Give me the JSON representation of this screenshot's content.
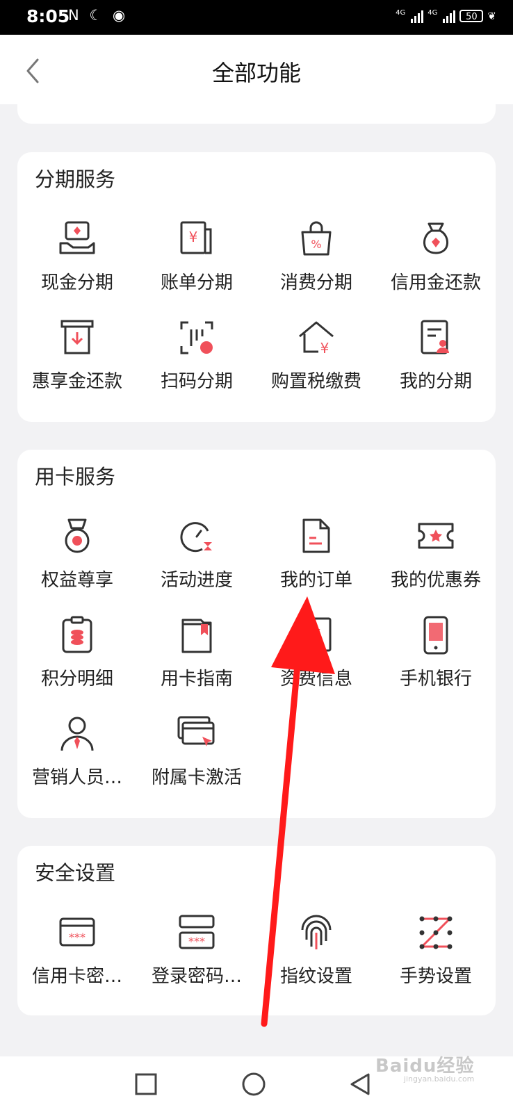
{
  "status_bar": {
    "time": "8:05",
    "left_icons": "N ☾ ◉",
    "signal1_label": "4G",
    "signal2_label": "4G",
    "battery": "50"
  },
  "header": {
    "title": "全部功能"
  },
  "sections": [
    {
      "title": "分期服务",
      "items": [
        {
          "label": "现金分期",
          "icon": "cash-installment-icon"
        },
        {
          "label": "账单分期",
          "icon": "bill-installment-icon"
        },
        {
          "label": "消费分期",
          "icon": "shopping-bag-icon"
        },
        {
          "label": "信用金还款",
          "icon": "money-bag-icon"
        },
        {
          "label": "惠享金还款",
          "icon": "download-box-icon"
        },
        {
          "label": "扫码分期",
          "icon": "scan-icon"
        },
        {
          "label": "购置税缴费",
          "icon": "house-yen-icon"
        },
        {
          "label": "我的分期",
          "icon": "document-person-icon"
        }
      ]
    },
    {
      "title": "用卡服务",
      "items": [
        {
          "label": "权益尊享",
          "icon": "medal-icon"
        },
        {
          "label": "活动进度",
          "icon": "progress-timer-icon"
        },
        {
          "label": "我的订单",
          "icon": "order-document-icon"
        },
        {
          "label": "我的优惠券",
          "icon": "coupon-icon"
        },
        {
          "label": "积分明细",
          "icon": "points-clipboard-icon"
        },
        {
          "label": "用卡指南",
          "icon": "guide-book-icon"
        },
        {
          "label": "资费信息",
          "icon": "fee-document-icon"
        },
        {
          "label": "手机银行",
          "icon": "mobile-phone-icon"
        },
        {
          "label": "营销人员…",
          "icon": "sales-person-icon"
        },
        {
          "label": "附属卡激活",
          "icon": "card-activate-icon"
        }
      ]
    },
    {
      "title": "安全设置",
      "items": [
        {
          "label": "信用卡密…",
          "icon": "card-password-icon"
        },
        {
          "label": "登录密码…",
          "icon": "login-password-icon"
        },
        {
          "label": "指纹设置",
          "icon": "fingerprint-icon"
        },
        {
          "label": "手势设置",
          "icon": "gesture-icon"
        }
      ]
    }
  ],
  "colors": {
    "accent": "#f0505a",
    "arrow": "#ff1a1a",
    "icon_stroke": "#333333"
  },
  "watermark": {
    "brand": "Baidu经验",
    "url": "jingyan.baidu.com"
  }
}
